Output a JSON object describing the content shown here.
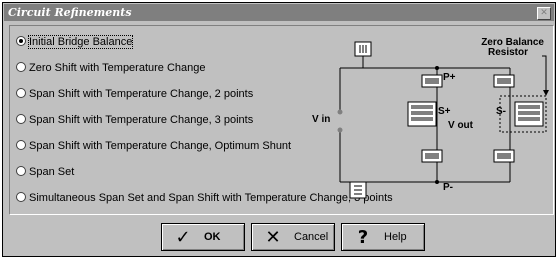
{
  "window": {
    "title": "Circuit Refinements",
    "close_glyph": "✕"
  },
  "options": [
    {
      "label": "Initial Bridge Balance",
      "selected": true
    },
    {
      "label": "Zero Shift with Temperature Change",
      "selected": false
    },
    {
      "label": "Span Shift with Temperature Change, 2 points",
      "selected": false
    },
    {
      "label": "Span Shift with Temperature Change, 3 points",
      "selected": false
    },
    {
      "label": "Span Shift with Temperature Change, Optimum Shunt",
      "selected": false
    },
    {
      "label": "Span Set",
      "selected": false
    },
    {
      "label": "Simultaneous Span Set and Span Shift with Temperature Change, 3 points",
      "selected": false
    }
  ],
  "diagram": {
    "zero_balance_label_1": "Zero Balance",
    "zero_balance_label_2": "Resistor",
    "p_plus": "P+",
    "p_minus": "P-",
    "s_plus": "S+",
    "s_minus": "S-",
    "v_in": "V in",
    "v_out": "V out"
  },
  "buttons": {
    "ok": {
      "label": "OK",
      "icon": "checkmark-icon",
      "glyph": "✓"
    },
    "cancel": {
      "label": "Cancel",
      "icon": "x-icon",
      "glyph": "✕"
    },
    "help": {
      "label": "Help",
      "icon": "question-icon",
      "glyph": "?"
    }
  }
}
